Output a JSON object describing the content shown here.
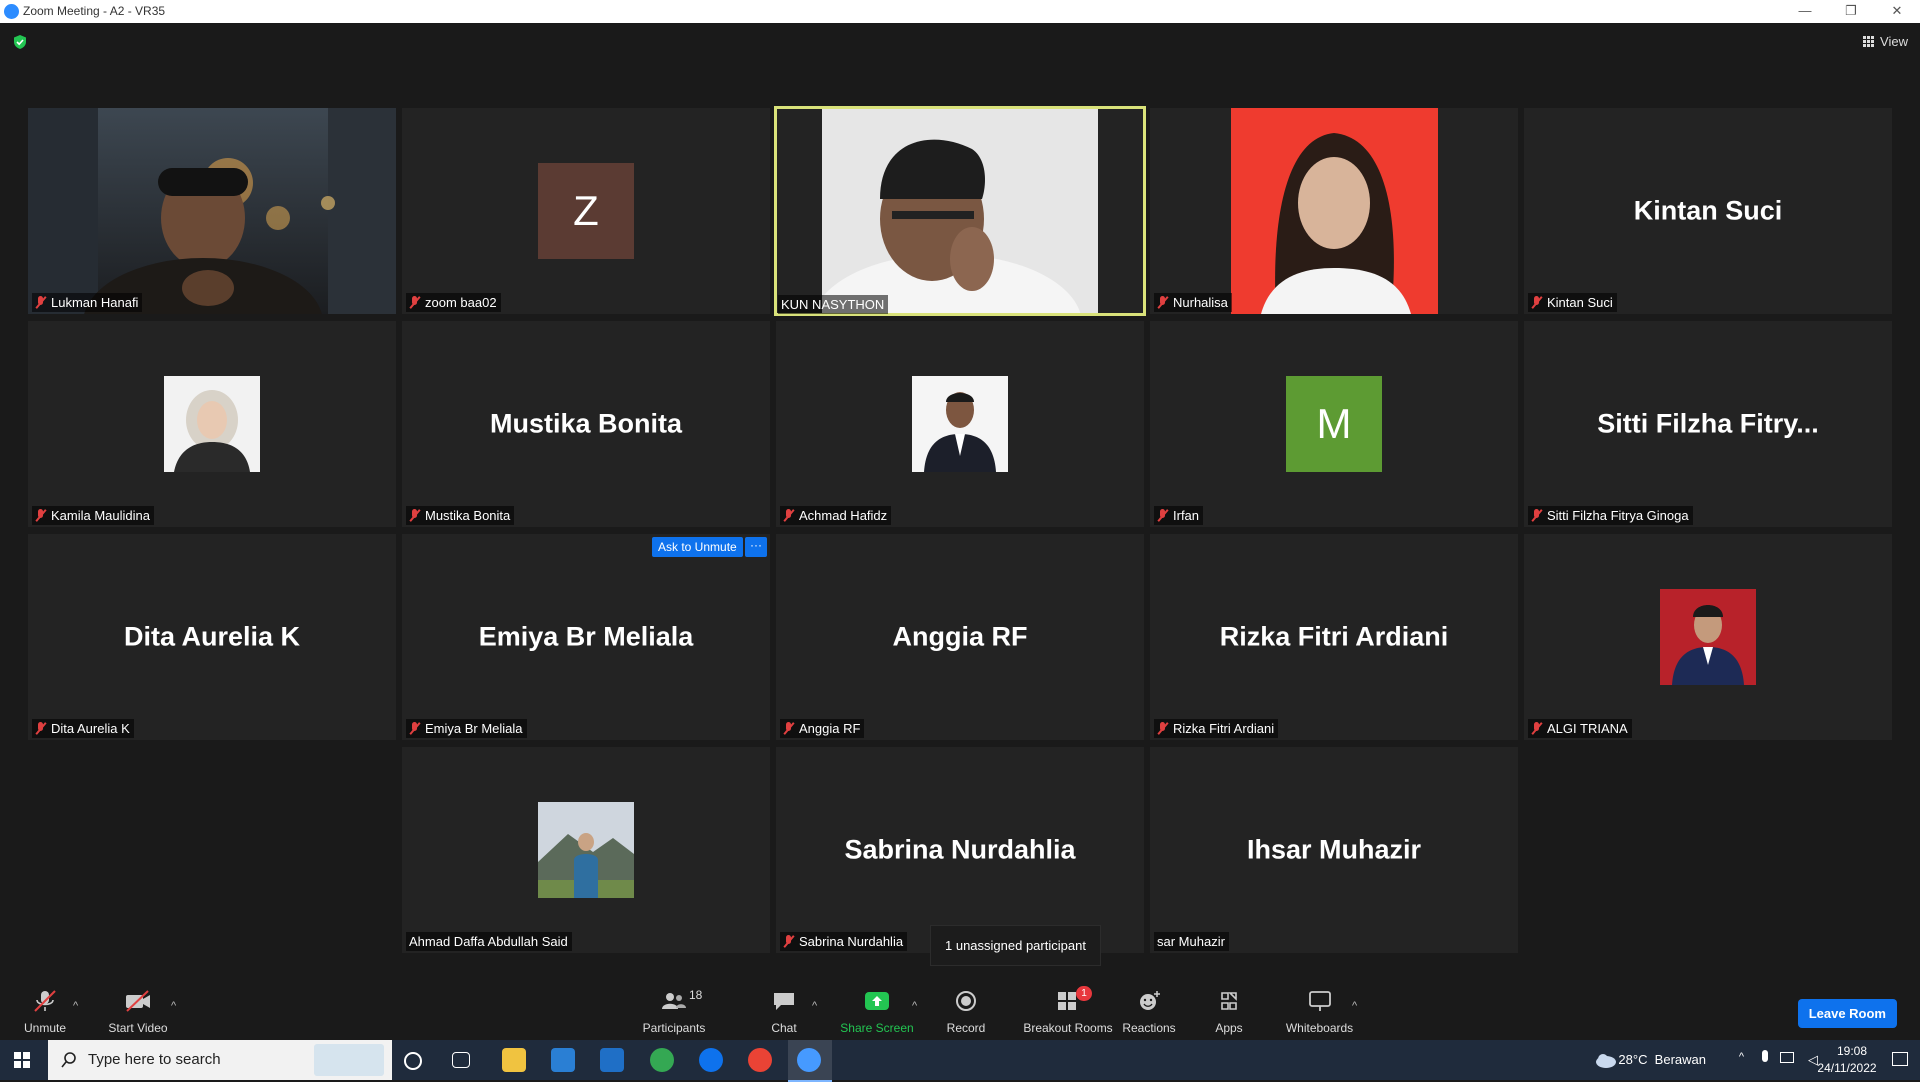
{
  "window": {
    "title": "Zoom Meeting - A2 - VR35"
  },
  "header": {
    "view_label": "View"
  },
  "tiles": [
    {
      "name": "Lukman Hanafi",
      "muted": true
    },
    {
      "name": "zoom baa02",
      "muted": true,
      "letter": "Z"
    },
    {
      "name": "KUN NASYTHON",
      "muted": false
    },
    {
      "name": "Nurhalisa",
      "muted": true
    },
    {
      "name": "Kintan Suci",
      "muted": true,
      "big": "Kintan Suci"
    },
    {
      "name": "Kamila Maulidina",
      "muted": true
    },
    {
      "name": "Mustika Bonita",
      "muted": true,
      "big": "Mustika Bonita"
    },
    {
      "name": "Achmad Hafidz",
      "muted": true
    },
    {
      "name": "Irfan",
      "muted": true,
      "letter": "M"
    },
    {
      "name": "Sitti Filzha Fitrya Ginoga",
      "muted": true,
      "big": "Sitti Filzha Fitry..."
    },
    {
      "name": "Dita Aurelia K",
      "muted": true,
      "big": "Dita Aurelia K"
    },
    {
      "name": "Emiya Br Meliala",
      "muted": true,
      "big": "Emiya Br Meliala"
    },
    {
      "name": "Anggia RF",
      "muted": true,
      "big": "Anggia RF"
    },
    {
      "name": "Rizka Fitri Ardiani",
      "muted": true,
      "big": "Rizka Fitri Ardiani"
    },
    {
      "name": "ALGI TRIANA",
      "muted": true
    },
    {
      "name": "Ahmad Daffa Abdullah Said",
      "muted": false
    },
    {
      "name": "Sabrina Nurdahlia",
      "muted": true,
      "big": "Sabrina Nurdahlia"
    },
    {
      "name": "sar Muhazir",
      "muted": false,
      "big": "Ihsar Muhazir"
    }
  ],
  "hover": {
    "ask_unmute": "Ask to Unmute",
    "more": "···"
  },
  "tooltip": {
    "text": "1 unassigned participant"
  },
  "toolbar": {
    "unmute": "Unmute",
    "start_video": "Start Video",
    "participants": "Participants",
    "participants_count": "18",
    "chat": "Chat",
    "share_screen": "Share Screen",
    "record": "Record",
    "breakout_rooms": "Breakout Rooms",
    "breakout_badge": "1",
    "reactions": "Reactions",
    "apps": "Apps",
    "whiteboards": "Whiteboards",
    "leave": "Leave Room"
  },
  "taskbar": {
    "search_placeholder": "Type here to search",
    "weather": "28°C  Berawan",
    "time": "19:08",
    "date": "24/11/2022"
  },
  "colors": {
    "accent_blue": "#0e72ed",
    "active_speaker": "#d9e27a",
    "share_green": "#23c552",
    "mute_red": "#e04040",
    "tile_bg": "#232323",
    "z_avatar": "#5b3b33",
    "m_avatar": "#5d9b33",
    "nurhalisa_bg": "#ef3b2f"
  }
}
